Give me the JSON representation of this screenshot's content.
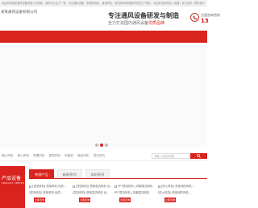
{
  "topbar": {
    "intro": "欢迎来到某某通风设备有限公司官网，通风专业生产厂家，专注通风设备、防爆排风机、管道风机、屋顶风机等设备的研发生产销售，欢迎来电咨询！",
    "links": "加入收藏 | 设为首页 | 联系我们"
  },
  "header": {
    "company": "某某通风设备有限公司",
    "slogan_title": "专注通风设备研发与制造",
    "slogan_sub_prefix": "全力打造国内通风设备",
    "slogan_sub_highlight": "优质品牌",
    "hotline_label": "全国咨询热线",
    "hotline_number": "13"
  },
  "search": {
    "hot_items": [
      "圆心风机",
      "离心风机",
      "防爆风机",
      "屋顶风机",
      "风幕机",
      "轴流风机",
      "混流风机"
    ],
    "placeholder": "请输入关键词搜索"
  },
  "category": {
    "title": "产品设备",
    "subtitle": "PRODUCT CENTER"
  },
  "tabs": [
    "热销产品",
    "新款系列",
    "风机系列"
  ],
  "products": [
    {
      "cap1": "[混流风机] 低噪风机 优质...",
      "cap2": "[混流风机] 低噪风机 优质...",
      "button": "立即咨询"
    },
    {
      "cap1": "[混流风机] 低噪混流风机 优...",
      "cap2": "[混流风机] 低噪混流风机 优...",
      "button": "立即咨询"
    },
    {
      "cap1": "PPT混流风机 | 排烟混流风机",
      "cap2": "PPT混流风机 | 排烟混流风机",
      "button": "立即咨询"
    },
    {
      "cap1": "[防火风机] 低噪消防风机...",
      "cap2": "[防火风机] 低噪消防风机...",
      "button": "立即咨询"
    }
  ],
  "colors": {
    "accent": "#d9231e",
    "banner": "#fafafa"
  },
  "carousel": {
    "slides": 3,
    "active_slide": 2
  }
}
